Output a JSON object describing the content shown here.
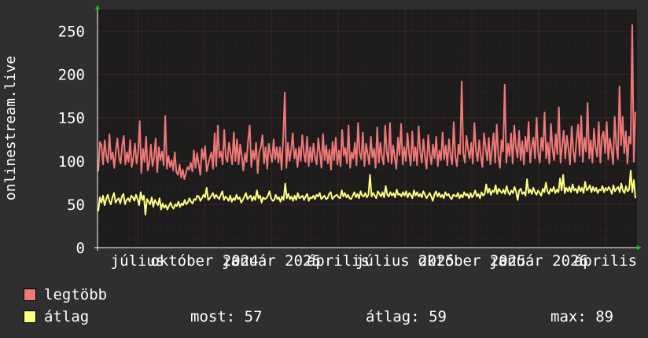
{
  "chart_data": {
    "type": "line",
    "ylabel": "onlinestream.live",
    "ylim": [
      0,
      275
    ],
    "yticks": [
      0,
      50,
      100,
      150,
      200,
      250
    ],
    "x_tick_labels": [
      "július",
      "október 2024",
      "január 2025",
      "április",
      "július 2025",
      "október 2025",
      "január 2026",
      "április"
    ],
    "series": [
      {
        "name": "legtöbb",
        "color": "#f07878",
        "values": [
          88,
          122,
          118,
          96,
          124,
          106,
          98,
          131,
          102,
          110,
          92,
          112,
          126,
          104,
          97,
          118,
          129,
          96,
          110,
          99,
          124,
          93,
          104,
          120,
          97,
          110,
          146,
          86,
          114,
          99,
          128,
          89,
          97,
          119,
          94,
          104,
          126,
          87,
          116,
          101,
          111,
          95,
          152,
          91,
          106,
          93,
          101,
          89,
          110,
          87,
          84,
          96,
          81,
          90,
          79,
          86,
          93,
          90,
          98,
          88,
          112,
          92,
          109,
          96,
          84,
          114,
          102,
          117,
          88,
          96,
          104,
          110,
          91,
          132,
          94,
          141,
          104,
          111,
          96,
          136,
          104,
          99,
          121,
          109,
          96,
          133,
          100,
          125,
          96,
          119,
          106,
          89,
          109,
          99,
          124,
          141,
          93,
          112,
          102,
          121,
          86,
          110,
          116,
          130,
          97,
          116,
          91,
          120,
          108,
          99,
          125,
          102,
          116,
          98,
          116,
          90,
          126,
          179,
          92,
          121,
          100,
          113,
          132,
          103,
          114,
          93,
          116,
          100,
          130,
          108,
          99,
          128,
          94,
          116,
          99,
          120,
          105,
          96,
          126,
          110,
          92,
          131,
          101,
          118,
          97,
          113,
          90,
          122,
          101,
          127,
          96,
          112,
          94,
          136,
          106,
          115,
          97,
          141,
          92,
          110,
          103,
          121,
          95,
          144,
          109,
          102,
          133,
          94,
          120,
          108,
          96,
          128,
          104,
          114,
          92,
          139,
          98,
          121,
          105,
          96,
          141,
          110,
          99,
          144,
          97,
          118,
          104,
          91,
          127,
          107,
          143,
          96,
          116,
          100,
          132,
          108,
          95,
          134,
          100,
          116,
          95,
          140,
          110,
          98,
          125,
          104,
          91,
          130,
          108,
          96,
          119,
          103,
          128,
          94,
          112,
          101,
          133,
          102,
          118,
          95,
          125,
          107,
          96,
          145,
          105,
          94,
          119,
          108,
          192,
          109,
          98,
          129,
          113,
          103,
          121,
          97,
          144,
          111,
          100,
          124,
          105,
          93,
          132,
          116,
          101,
          127,
          96,
          113,
          132,
          98,
          142,
          106,
          92,
          124,
          111,
          188,
          98,
          120,
          106,
          132,
          97,
          141,
          116,
          104,
          135,
          101,
          123,
          96,
          128,
          111,
          145,
          98,
          117,
          127,
          103,
          150,
          109,
          98,
          127,
          112,
          156,
          103,
          121,
          97,
          143,
          114,
          101,
          131,
          108,
          162,
          98,
          117,
          135,
          103,
          129,
          114,
          96,
          140,
          112,
          99,
          124,
          142,
          106,
          152,
          99,
          127,
          111,
          167,
          103,
          124,
          98,
          137,
          116,
          105,
          145,
          98,
          128,
          134,
          109,
          145,
          102,
          126,
          113,
          96,
          151,
          117,
          102,
          186,
          118,
          151,
          109,
          134,
          97,
          128,
          120,
          257,
          99,
          157
        ]
      },
      {
        "name": "átlag",
        "color": "#ffff80",
        "values": [
          42,
          58,
          52,
          60,
          49,
          56,
          61,
          54,
          50,
          58,
          63,
          52,
          55,
          57,
          51,
          59,
          62,
          50,
          55,
          57,
          53,
          60,
          58,
          54,
          61,
          56,
          49,
          64,
          55,
          60,
          38,
          56,
          53,
          50,
          58,
          47,
          55,
          52,
          49,
          57,
          44,
          51,
          46,
          49,
          44,
          48,
          52,
          47,
          45,
          50,
          48,
          53,
          47,
          51,
          49,
          55,
          50,
          52,
          57,
          53,
          51,
          56,
          55,
          60,
          59,
          54,
          57,
          61,
          58,
          69,
          55,
          57,
          60,
          63,
          57,
          61,
          58,
          56,
          61,
          65,
          55,
          59,
          57,
          54,
          60,
          53,
          57,
          55,
          61,
          56,
          58,
          52,
          55,
          59,
          63,
          56,
          58,
          60,
          54,
          59,
          55,
          66,
          57,
          60,
          52,
          58,
          56,
          57,
          60,
          65,
          57,
          54,
          55,
          61,
          56,
          58,
          53,
          59,
          55,
          74,
          57,
          62,
          56,
          59,
          54,
          60,
          55,
          63,
          57,
          58,
          60,
          55,
          59,
          62,
          54,
          58,
          57,
          60,
          56,
          61,
          59,
          63,
          56,
          58,
          60,
          56,
          57,
          62,
          64,
          56,
          58,
          60,
          61,
          58,
          57,
          66,
          59,
          63,
          58,
          61,
          57,
          56,
          60,
          64,
          58,
          62,
          57,
          65,
          60,
          59,
          63,
          58,
          61,
          84,
          59,
          63,
          60,
          57,
          65,
          62,
          59,
          64,
          58,
          71,
          61,
          59,
          64,
          60,
          63,
          58,
          67,
          61,
          62,
          59,
          64,
          60,
          65,
          58,
          63,
          61,
          57,
          66,
          60,
          64,
          59,
          62,
          58,
          65,
          61,
          57,
          60,
          63,
          59,
          54,
          61,
          65,
          59,
          63,
          58,
          61,
          57,
          64,
          60,
          62,
          58,
          56,
          61,
          60,
          59,
          63,
          57,
          61,
          58,
          64,
          60,
          62,
          57,
          63,
          58,
          61,
          66,
          59,
          62,
          57,
          64,
          60,
          62,
          73,
          63,
          68,
          61,
          66,
          64,
          72,
          62,
          68,
          65,
          63,
          67,
          62,
          71,
          64,
          61,
          66,
          63,
          70,
          65,
          55,
          66,
          68,
          62,
          64,
          60,
          79,
          63,
          67,
          62,
          69,
          64,
          61,
          66,
          63,
          60,
          68,
          64,
          75,
          65,
          62,
          68,
          65,
          70,
          63,
          67,
          64,
          80,
          66,
          84,
          63,
          69,
          65,
          70,
          64,
          73,
          66,
          68,
          63,
          71,
          65,
          69,
          63,
          76,
          66,
          68,
          72,
          64,
          70,
          65,
          69,
          63,
          67,
          66,
          71,
          64,
          69,
          66,
          70,
          67,
          62,
          72,
          65,
          68,
          70,
          64,
          74,
          66,
          63,
          71,
          65,
          67,
          89,
          64,
          78,
          57
        ]
      }
    ],
    "grid": true
  },
  "legend": {
    "items": [
      {
        "label": "legtöbb",
        "color": "#f07878"
      },
      {
        "label": "átlag",
        "color": "#ffff80"
      }
    ],
    "stats": {
      "now_label": "most: 57",
      "avg_label": "átlag: 59",
      "max_label": "max: 89"
    }
  }
}
